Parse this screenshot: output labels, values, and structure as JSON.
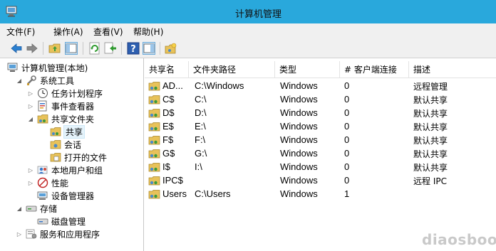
{
  "window": {
    "title": "计算机管理"
  },
  "menu": [
    "文件(F)",
    "操作(A)",
    "查看(V)",
    "帮助(H)"
  ],
  "toolbar": {
    "buttons": [
      "back-icon",
      "forward-icon",
      "up-folder-icon",
      "show-hide-console-tree-icon",
      "refresh-icon",
      "export-list-icon",
      "help-icon",
      "show-hide-action-pane-icon",
      "new-share-icon"
    ]
  },
  "tree": {
    "root": "计算机管理(本地)",
    "system_tools": "系统工具",
    "task_scheduler": "任务计划程序",
    "event_viewer": "事件查看器",
    "shared_folders": "共享文件夹",
    "shares": "共享",
    "sessions": "会话",
    "open_files": "打开的文件",
    "local_users": "本地用户和组",
    "performance": "性能",
    "device_manager": "设备管理器",
    "storage": "存储",
    "disk_management": "磁盘管理",
    "services_apps": "服务和应用程序"
  },
  "columns": [
    "共享名",
    "文件夹路径",
    "类型",
    "# 客户端连接",
    "描述"
  ],
  "rows": [
    {
      "name": "AD...",
      "path": "C:\\Windows",
      "type": "Windows",
      "clients": "0",
      "desc": "远程管理"
    },
    {
      "name": "C$",
      "path": "C:\\",
      "type": "Windows",
      "clients": "0",
      "desc": "默认共享"
    },
    {
      "name": "D$",
      "path": "D:\\",
      "type": "Windows",
      "clients": "0",
      "desc": "默认共享"
    },
    {
      "name": "E$",
      "path": "E:\\",
      "type": "Windows",
      "clients": "0",
      "desc": "默认共享"
    },
    {
      "name": "F$",
      "path": "F:\\",
      "type": "Windows",
      "clients": "0",
      "desc": "默认共享"
    },
    {
      "name": "G$",
      "path": "G:\\",
      "type": "Windows",
      "clients": "0",
      "desc": "默认共享"
    },
    {
      "name": "I$",
      "path": "I:\\",
      "type": "Windows",
      "clients": "0",
      "desc": "默认共享"
    },
    {
      "name": "IPC$",
      "path": "",
      "type": "Windows",
      "clients": "0",
      "desc": "远程 IPC"
    },
    {
      "name": "Users",
      "path": "C:\\Users",
      "type": "Windows",
      "clients": "1",
      "desc": ""
    }
  ],
  "watermark": "diaosbook",
  "colors": {
    "titlebar": "#29a8dc",
    "chrome": "#f0f0f0",
    "selection": "#e5f3fb"
  }
}
